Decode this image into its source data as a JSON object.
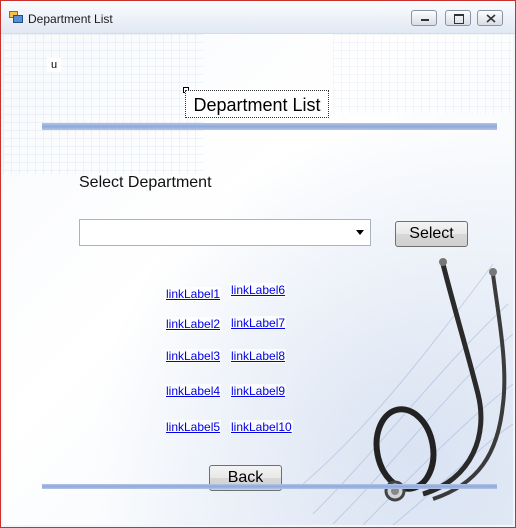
{
  "window": {
    "title": "Department List"
  },
  "titlebar": {
    "icon": "app-window-icon",
    "controls": [
      "minimize-icon",
      "restore-icon",
      "close-icon"
    ]
  },
  "misc": {
    "u_label": "u"
  },
  "form": {
    "title": "Department List",
    "select_label": "Select Department",
    "department_combo": {
      "value": ""
    },
    "select_button": "Select",
    "back_button": "Back"
  },
  "links": {
    "col1": [
      "linkLabel1",
      "linkLabel2",
      "linkLabel3",
      "linkLabel4",
      "linkLabel5"
    ],
    "col2": [
      "linkLabel6",
      "linkLabel7",
      "linkLabel8",
      "linkLabel9",
      "linkLabel10"
    ]
  },
  "colors": {
    "accent_bar": "#9fb4e0",
    "link": "#0000e6",
    "window_border": "#c8312d"
  }
}
